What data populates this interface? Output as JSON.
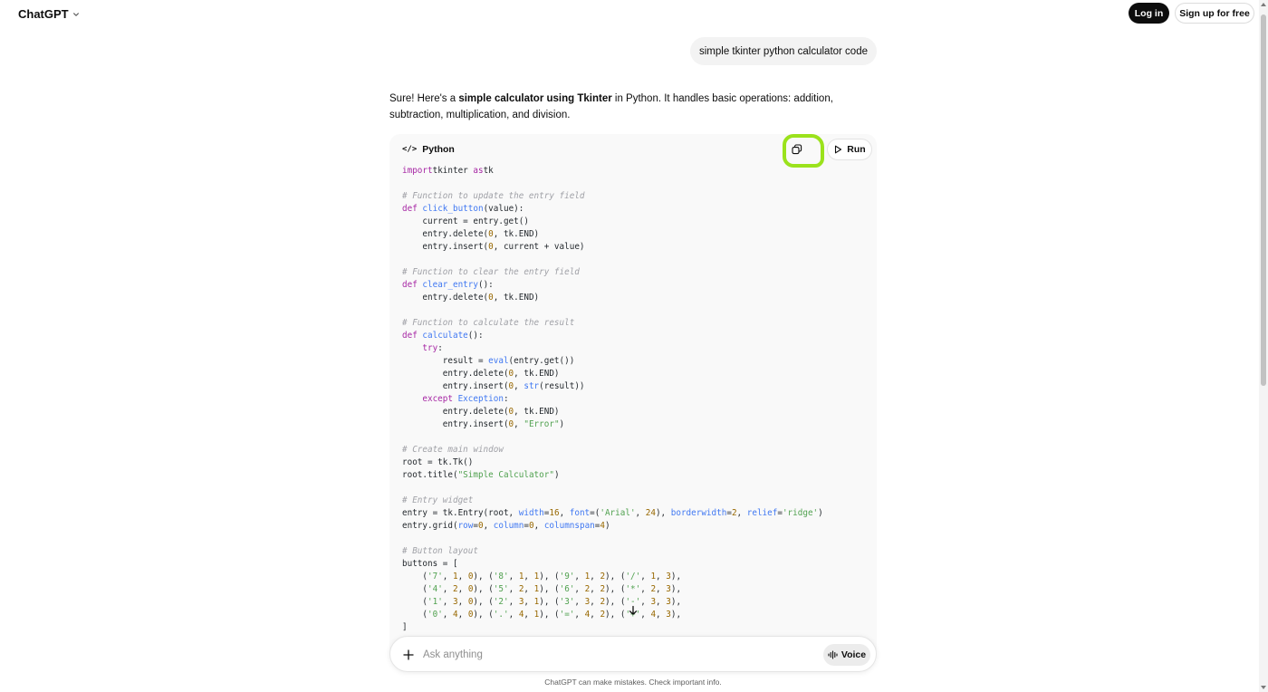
{
  "header": {
    "brand": "ChatGPT",
    "login_label": "Log in",
    "signup_label": "Sign up for free"
  },
  "conversation": {
    "user_message": "simple tkinter python calculator code",
    "reply": {
      "part1": "Sure! Here's a ",
      "bold": "simple calculator using Tkinter",
      "part2": " in Python. It handles basic operations: addition, subtraction, multiplication, and division."
    }
  },
  "code_block": {
    "language": "Python",
    "lang_icon": "</>",
    "run_label": "Run",
    "lines": [
      [
        [
          "kw",
          "import"
        ],
        [
          "",
          "tkinter"
        ],
        [
          "kw",
          " as"
        ],
        [
          "",
          "tk"
        ]
      ],
      [],
      [
        [
          "cm",
          "# Function to update the entry field"
        ]
      ],
      [
        [
          "kw",
          "def"
        ],
        [
          "",
          " "
        ],
        [
          "fn",
          "click_button"
        ],
        [
          "",
          "(value):"
        ]
      ],
      [
        [
          "",
          "    current = entry.get()"
        ]
      ],
      [
        [
          "",
          "    entry.delete("
        ],
        [
          "nm",
          "0"
        ],
        [
          "",
          ", tk.END)"
        ]
      ],
      [
        [
          "",
          "    entry.insert("
        ],
        [
          "nm",
          "0"
        ],
        [
          "",
          ", current + value)"
        ]
      ],
      [],
      [
        [
          "cm",
          "# Function to clear the entry field"
        ]
      ],
      [
        [
          "kw",
          "def"
        ],
        [
          "",
          " "
        ],
        [
          "fn",
          "clear_entry"
        ],
        [
          "",
          "():"
        ]
      ],
      [
        [
          "",
          "    entry.delete("
        ],
        [
          "nm",
          "0"
        ],
        [
          "",
          ", tk.END)"
        ]
      ],
      [],
      [
        [
          "cm",
          "# Function to calculate the result"
        ]
      ],
      [
        [
          "kw",
          "def"
        ],
        [
          "",
          " "
        ],
        [
          "fn",
          "calculate"
        ],
        [
          "",
          "():"
        ]
      ],
      [
        [
          "kw",
          "    try"
        ],
        [
          "",
          ":"
        ]
      ],
      [
        [
          "",
          "        result = "
        ],
        [
          "fn",
          "eval"
        ],
        [
          "",
          "(entry.get())"
        ]
      ],
      [
        [
          "",
          "        entry.delete("
        ],
        [
          "nm",
          "0"
        ],
        [
          "",
          ", tk.END)"
        ]
      ],
      [
        [
          "",
          "        entry.insert("
        ],
        [
          "nm",
          "0"
        ],
        [
          "",
          ", "
        ],
        [
          "fn",
          "str"
        ],
        [
          "",
          "(result))"
        ]
      ],
      [
        [
          "kw",
          "    except"
        ],
        [
          "fn",
          " Exception"
        ],
        [
          "",
          ":"
        ]
      ],
      [
        [
          "",
          "        entry.delete("
        ],
        [
          "nm",
          "0"
        ],
        [
          "",
          ", tk.END)"
        ]
      ],
      [
        [
          "",
          "        entry.insert("
        ],
        [
          "nm",
          "0"
        ],
        [
          "",
          ", "
        ],
        [
          "st",
          "\"Error\""
        ],
        [
          "",
          ")"
        ]
      ],
      [],
      [
        [
          "cm",
          "# Create main window"
        ]
      ],
      [
        [
          "",
          "root = tk.Tk()"
        ]
      ],
      [
        [
          "",
          "root.title("
        ],
        [
          "st",
          "\"Simple Calculator\""
        ],
        [
          "",
          ")"
        ]
      ],
      [],
      [
        [
          "cm",
          "# Entry widget"
        ]
      ],
      [
        [
          "",
          "entry = tk.Entry(root, "
        ],
        [
          "at",
          "width"
        ],
        [
          "",
          "="
        ],
        [
          "nm",
          "16"
        ],
        [
          "",
          ", "
        ],
        [
          "at",
          "font"
        ],
        [
          "",
          "=("
        ],
        [
          "st",
          "'Arial'"
        ],
        [
          "",
          ", "
        ],
        [
          "nm",
          "24"
        ],
        [
          "",
          "), "
        ],
        [
          "at",
          "borderwidth"
        ],
        [
          "",
          "="
        ],
        [
          "nm",
          "2"
        ],
        [
          "",
          ", "
        ],
        [
          "at",
          "relief"
        ],
        [
          "",
          "="
        ],
        [
          "st",
          "'ridge'"
        ],
        [
          "",
          ")"
        ]
      ],
      [
        [
          "",
          "entry.grid("
        ],
        [
          "at",
          "row"
        ],
        [
          "",
          "="
        ],
        [
          "nm",
          "0"
        ],
        [
          "",
          ", "
        ],
        [
          "at",
          "column"
        ],
        [
          "",
          "="
        ],
        [
          "nm",
          "0"
        ],
        [
          "",
          ", "
        ],
        [
          "at",
          "columnspan"
        ],
        [
          "",
          "="
        ],
        [
          "nm",
          "4"
        ],
        [
          "",
          ")"
        ]
      ],
      [],
      [
        [
          "cm",
          "# Button layout"
        ]
      ],
      [
        [
          "",
          "buttons = ["
        ]
      ],
      [
        [
          "",
          "    ("
        ],
        [
          "st",
          "'7'"
        ],
        [
          "",
          ", "
        ],
        [
          "nm",
          "1"
        ],
        [
          "",
          ", "
        ],
        [
          "nm",
          "0"
        ],
        [
          "",
          "), ("
        ],
        [
          "st",
          "'8'"
        ],
        [
          "",
          ", "
        ],
        [
          "nm",
          "1"
        ],
        [
          "",
          ", "
        ],
        [
          "nm",
          "1"
        ],
        [
          "",
          "), ("
        ],
        [
          "st",
          "'9'"
        ],
        [
          "",
          ", "
        ],
        [
          "nm",
          "1"
        ],
        [
          "",
          ", "
        ],
        [
          "nm",
          "2"
        ],
        [
          "",
          "), ("
        ],
        [
          "st",
          "'/'"
        ],
        [
          "",
          ", "
        ],
        [
          "nm",
          "1"
        ],
        [
          "",
          ", "
        ],
        [
          "nm",
          "3"
        ],
        [
          "",
          "),"
        ]
      ],
      [
        [
          "",
          "    ("
        ],
        [
          "st",
          "'4'"
        ],
        [
          "",
          ", "
        ],
        [
          "nm",
          "2"
        ],
        [
          "",
          ", "
        ],
        [
          "nm",
          "0"
        ],
        [
          "",
          "), ("
        ],
        [
          "st",
          "'5'"
        ],
        [
          "",
          ", "
        ],
        [
          "nm",
          "2"
        ],
        [
          "",
          ", "
        ],
        [
          "nm",
          "1"
        ],
        [
          "",
          "), ("
        ],
        [
          "st",
          "'6'"
        ],
        [
          "",
          ", "
        ],
        [
          "nm",
          "2"
        ],
        [
          "",
          ", "
        ],
        [
          "nm",
          "2"
        ],
        [
          "",
          "), ("
        ],
        [
          "st",
          "'*'"
        ],
        [
          "",
          ", "
        ],
        [
          "nm",
          "2"
        ],
        [
          "",
          ", "
        ],
        [
          "nm",
          "3"
        ],
        [
          "",
          "),"
        ]
      ],
      [
        [
          "",
          "    ("
        ],
        [
          "st",
          "'1'"
        ],
        [
          "",
          ", "
        ],
        [
          "nm",
          "3"
        ],
        [
          "",
          ", "
        ],
        [
          "nm",
          "0"
        ],
        [
          "",
          "), ("
        ],
        [
          "st",
          "'2'"
        ],
        [
          "",
          ", "
        ],
        [
          "nm",
          "3"
        ],
        [
          "",
          ", "
        ],
        [
          "nm",
          "1"
        ],
        [
          "",
          "), ("
        ],
        [
          "st",
          "'3'"
        ],
        [
          "",
          ", "
        ],
        [
          "nm",
          "3"
        ],
        [
          "",
          ", "
        ],
        [
          "nm",
          "2"
        ],
        [
          "",
          "), ("
        ],
        [
          "st",
          "'-'"
        ],
        [
          "",
          ", "
        ],
        [
          "nm",
          "3"
        ],
        [
          "",
          ", "
        ],
        [
          "nm",
          "3"
        ],
        [
          "",
          "),"
        ]
      ],
      [
        [
          "",
          "    ("
        ],
        [
          "st",
          "'0'"
        ],
        [
          "",
          ", "
        ],
        [
          "nm",
          "4"
        ],
        [
          "",
          ", "
        ],
        [
          "nm",
          "0"
        ],
        [
          "",
          "), ("
        ],
        [
          "st",
          "'.'"
        ],
        [
          "",
          ", "
        ],
        [
          "nm",
          "4"
        ],
        [
          "",
          ", "
        ],
        [
          "nm",
          "1"
        ],
        [
          "",
          "), ("
        ],
        [
          "st",
          "'='"
        ],
        [
          "",
          ", "
        ],
        [
          "nm",
          "4"
        ],
        [
          "",
          ", "
        ],
        [
          "nm",
          "2"
        ],
        [
          "",
          "), ("
        ],
        [
          "st",
          "'+'"
        ],
        [
          "",
          ", "
        ],
        [
          "nm",
          "4"
        ],
        [
          "",
          ", "
        ],
        [
          "nm",
          "3"
        ],
        [
          "",
          "),"
        ]
      ],
      [
        [
          "",
          "]"
        ]
      ]
    ]
  },
  "composer": {
    "placeholder": "Ask anything",
    "voice_label": "Voice"
  },
  "footer": {
    "note": "ChatGPT can make mistakes. Check important info."
  },
  "icons": {
    "brand_chevron": "chevron-down-icon",
    "copy": "copy-icon",
    "run": "play-icon",
    "scroll_down": "arrow-down-icon",
    "plus": "plus-icon",
    "voice": "voice-waveform-icon",
    "code": "code-icon"
  },
  "colors": {
    "highlight": "#9be21c",
    "primary_button": "#0d0d0d",
    "code_background": "#f9f9f9",
    "user_bubble": "#f3f3f3"
  }
}
